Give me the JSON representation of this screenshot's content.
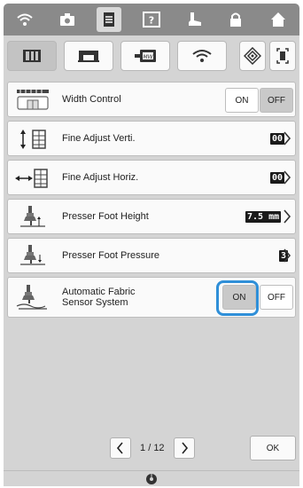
{
  "statusbar": {
    "icons": [
      "wifi-icon",
      "camera-icon",
      "settings-page-icon",
      "help-icon",
      "presser-foot-lift-icon",
      "lock-icon",
      "home-icon"
    ],
    "selected": "settings-page-icon"
  },
  "tabs": {
    "items": [
      "machine-settings-icon",
      "sewing-machine-icon",
      "embroidery-settings-icon",
      "wlan-icon"
    ],
    "selected": "machine-settings-icon",
    "extra": [
      "memory-icon",
      "screen-icon"
    ]
  },
  "rows": [
    {
      "label": "Width Control",
      "on_label": "ON",
      "off_label": "OFF",
      "selected": "OFF"
    },
    {
      "label": "Fine Adjust Verti.",
      "value": "00"
    },
    {
      "label": "Fine Adjust Horiz.",
      "value": "00"
    },
    {
      "label": "Presser Foot Height",
      "value": "7.5 mm"
    },
    {
      "label": "Presser Foot Pressure",
      "value": "3"
    },
    {
      "label_line1": "Automatic Fabric",
      "label_line2": "Sensor System",
      "on_label": "ON",
      "off_label": "OFF",
      "selected": "ON"
    }
  ],
  "pager": {
    "current": "1",
    "separator": "/",
    "total": "12"
  },
  "ok_label": "OK",
  "colors": {
    "highlight": "#2f8fd8",
    "panel": "#d4d4d4",
    "statusbar": "#8a8a8a"
  }
}
